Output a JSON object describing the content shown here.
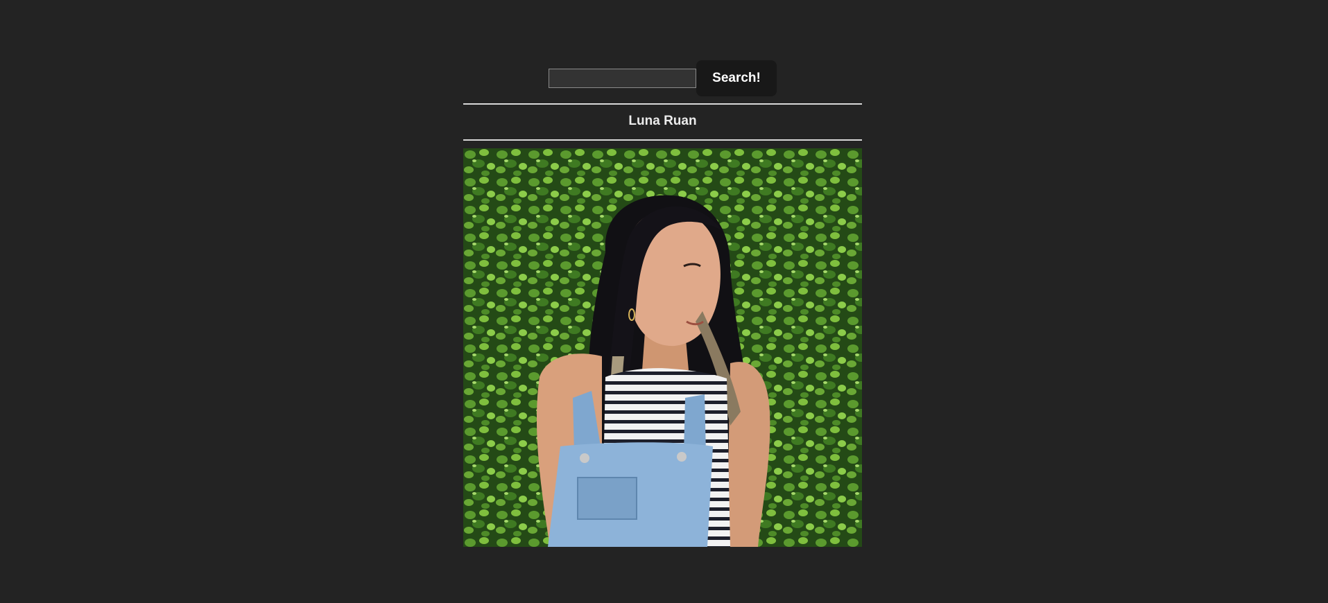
{
  "search": {
    "value": "",
    "placeholder": "",
    "button_label": "Search!"
  },
  "profile": {
    "name": "Luna Ruan",
    "photo_icon": "profile-photo"
  },
  "colors": {
    "background": "#232323",
    "button": "#181818",
    "text": "#ececec",
    "divider": "#d9d9d9"
  }
}
